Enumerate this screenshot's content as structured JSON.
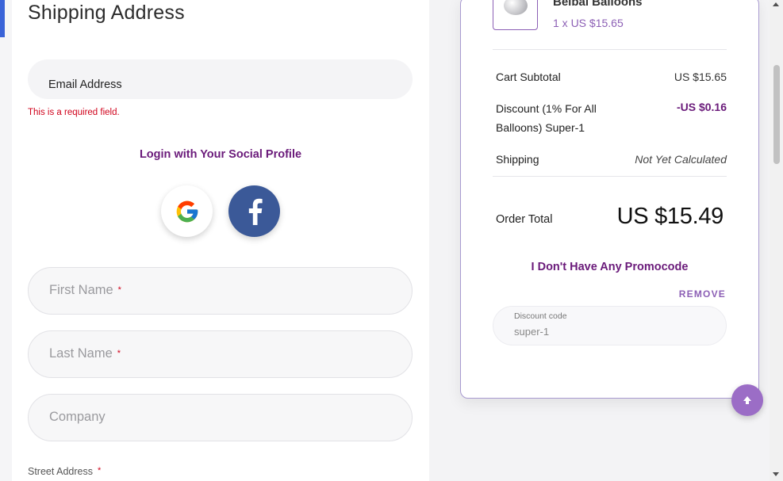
{
  "shipping": {
    "title": "Shipping Address",
    "email_label": "Email Address",
    "email_error": "This is a required field.",
    "social_title": "Login with Your Social Profile",
    "social_buttons": [
      "google-icon",
      "facebook-icon"
    ],
    "fields": {
      "first_name": "First Name",
      "last_name": "Last Name",
      "company": "Company",
      "street_address": "Street Address"
    },
    "required_marker": "*"
  },
  "cart": {
    "product_name": "Belbal Balloons",
    "product_qty": "1 x US $15.65",
    "subtotal_label": "Cart Subtotal",
    "subtotal_value": "US $15.65",
    "discount_label_line1": "Discount (1% For All",
    "discount_label_line2": "Balloons) Super-1",
    "discount_value": "-US $0.16",
    "shipping_label": "Shipping",
    "shipping_value": "Not Yet Calculated",
    "total_label": "Order Total",
    "total_value": "US $15.49",
    "promo_link": "I Don't Have Any Promocode",
    "remove_link": "REMOVE",
    "discount_code_label": "Discount code",
    "discount_code_value": "super-1"
  },
  "colors": {
    "accent_purple": "#6a1a7a",
    "light_purple": "#8c5fb5",
    "facebook_blue": "#3b5998",
    "error_red": "#d0021b"
  }
}
